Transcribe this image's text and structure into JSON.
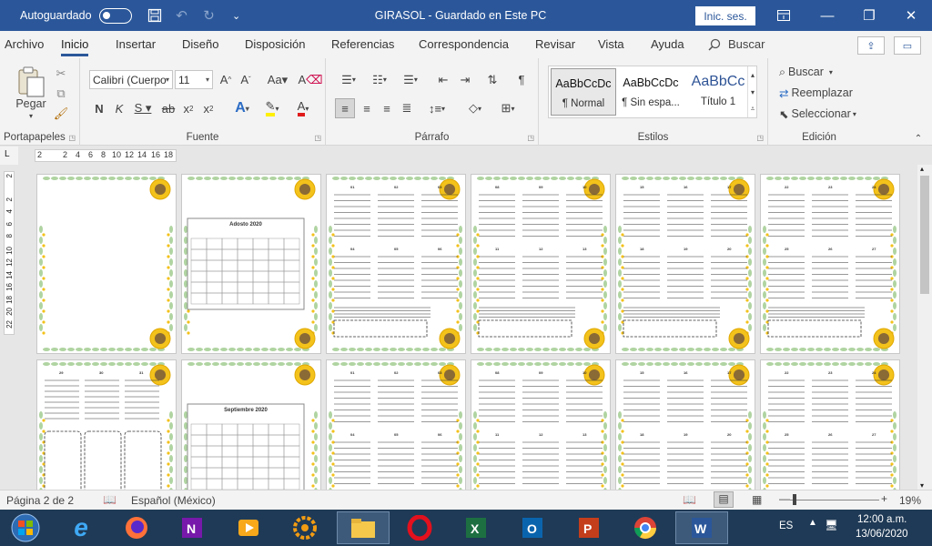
{
  "titlebar": {
    "autosave_label": "Autoguardado",
    "title": "GIRASOL  -  Guardado en Este PC",
    "signin_label": "Inic. ses."
  },
  "tabs": [
    "Archivo",
    "Inicio",
    "Insertar",
    "Diseño",
    "Disposición",
    "Referencias",
    "Correspondencia",
    "Revisar",
    "Vista",
    "Ayuda"
  ],
  "active_tab": "Inicio",
  "search_label": "Buscar",
  "ribbon": {
    "clipboard": {
      "paste_label": "Pegar",
      "group_label": "Portapapeles"
    },
    "font": {
      "font_name": "Calibri (Cuerpo",
      "font_size": "11",
      "group_label": "Fuente"
    },
    "paragraph": {
      "group_label": "Párrafo"
    },
    "styles": {
      "items": [
        {
          "preview": "AaBbCcDc",
          "name": "¶ Normal"
        },
        {
          "preview": "AaBbCcDc",
          "name": "¶ Sin espa..."
        },
        {
          "preview": "AaBbCc",
          "name": "Título 1"
        }
      ],
      "group_label": "Estilos"
    },
    "editing": {
      "find_label": "Buscar",
      "replace_label": "Reemplazar",
      "select_label": "Seleccionar",
      "group_label": "Edición"
    }
  },
  "ruler": {
    "corner": "L",
    "h_ticks": [
      "2",
      "2",
      "4",
      "6",
      "8",
      "10",
      "12",
      "14",
      "16",
      "18"
    ],
    "v_ticks": [
      "2",
      "2",
      "4",
      "6",
      "8",
      "10",
      "12",
      "14",
      "16",
      "18",
      "20",
      "22"
    ]
  },
  "pages_row1": [
    {
      "type": "blank"
    },
    {
      "type": "calendar",
      "title": "Adosto 2020"
    },
    {
      "type": "planner",
      "days": [
        "01",
        "02",
        "03",
        "04",
        "05",
        "06",
        "07"
      ]
    },
    {
      "type": "planner",
      "days": [
        "08",
        "09",
        "10",
        "11",
        "12",
        "13",
        "14"
      ]
    },
    {
      "type": "planner",
      "days": [
        "15",
        "16",
        "17",
        "18",
        "19",
        "20",
        "21"
      ]
    },
    {
      "type": "planner",
      "days": [
        "22",
        "23",
        "24",
        "25",
        "26",
        "27",
        "28"
      ]
    }
  ],
  "pages_row2": [
    {
      "type": "planner-end",
      "days": [
        "29",
        "30",
        "31"
      ]
    },
    {
      "type": "calendar",
      "title": "Septiembre 2020"
    },
    {
      "type": "planner",
      "days": [
        "01",
        "02",
        "03",
        "04",
        "05",
        "06"
      ]
    },
    {
      "type": "planner",
      "days": [
        "08",
        "09",
        "10",
        "11",
        "12",
        "13"
      ]
    },
    {
      "type": "planner",
      "days": [
        "15",
        "16",
        "17",
        "18",
        "19",
        "20"
      ]
    },
    {
      "type": "planner",
      "days": [
        "22",
        "23",
        "24",
        "25",
        "26",
        "27"
      ]
    }
  ],
  "status": {
    "page": "Página 2 de 2",
    "language": "Español (México)",
    "zoom": "19%"
  },
  "tray": {
    "lang": "ES",
    "time": "12:00 a.m.",
    "date": "13/06/2020"
  },
  "colors": {
    "word_blue": "#2b579a",
    "taskbar": "#1f3a56",
    "sunflower": "#f3c21b"
  }
}
